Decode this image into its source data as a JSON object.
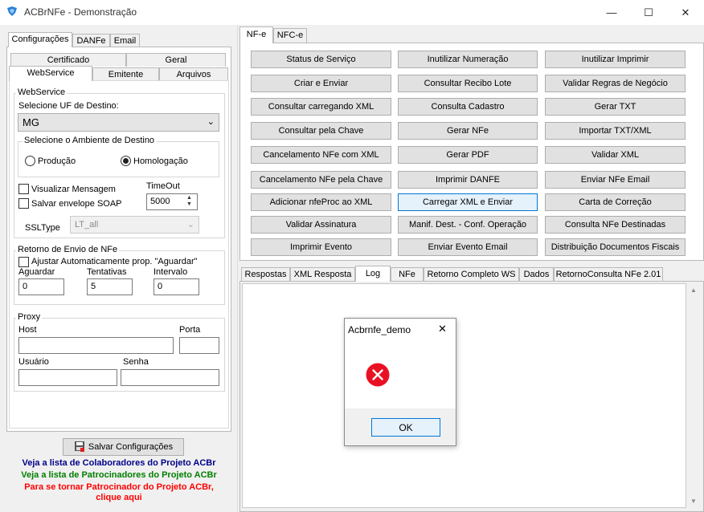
{
  "window": {
    "title": "ACBrNFe - Demonstração",
    "minimize": "—",
    "maximize": "☐",
    "close": "✕",
    "icon": "acbr-app-icon"
  },
  "left": {
    "tabs": [
      "Configurações",
      "DANFe",
      "Email"
    ],
    "subtabs_top": [
      "Certificado",
      "Geral"
    ],
    "subtabs_bottom": [
      "WebService",
      "Emitente",
      "Arquivos"
    ],
    "webservice": {
      "group_label": "WebService",
      "uf_label": "Selecione UF de Destino:",
      "uf_value": "MG",
      "ambiente_label": "Selecione o Ambiente de Destino",
      "producao": "Produção",
      "homologacao": "Homologação",
      "visualizar": "Visualizar Mensagem",
      "salvar_envelope": "Salvar envelope SOAP",
      "timeout_label": "TimeOut",
      "timeout_value": "5000",
      "ssltype_label": "SSLType",
      "ssltype_value": "LT_all"
    },
    "retorno": {
      "group_label": "Retorno de Envio de NFe",
      "ajustar": "Ajustar Automaticamente prop. \"Aguardar\"",
      "aguardar_label": "Aguardar",
      "aguardar_value": "0",
      "tentativas_label": "Tentativas",
      "tentativas_value": "5",
      "intervalo_label": "Intervalo",
      "intervalo_value": "0"
    },
    "proxy": {
      "group_label": "Proxy",
      "host_label": "Host",
      "porta_label": "Porta",
      "usuario_label": "Usuário",
      "senha_label": "Senha"
    },
    "save_button": "Salvar Configurações",
    "links": {
      "colaboradores": "Veja a lista de Colaboradores do Projeto ACBr",
      "patrocinadores": "Veja a lista de Patrocinadores do Projeto ACBr",
      "patrocinador_line1": "Para se tornar Patrocinador do Projeto ACBr,",
      "patrocinador_line2": "clique aqui"
    },
    "colors": {
      "blue": "#00008b",
      "green": "#008000",
      "red": "#ff0000"
    }
  },
  "right": {
    "tabs": [
      "NF-e",
      "NFC-e"
    ],
    "buttons": [
      [
        "Status de Serviço",
        "Inutilizar Numeração",
        "Inutilizar Imprimir"
      ],
      [
        "Criar e Enviar",
        "Consultar Recibo Lote",
        "Validar Regras de Negócio"
      ],
      [
        "Consultar carregando XML",
        "Consulta Cadastro",
        "Gerar TXT"
      ],
      [
        "Consultar pela Chave",
        "Gerar NFe",
        "Importar TXT/XML"
      ],
      [
        "Cancelamento NFe com XML",
        "Gerar PDF",
        "Validar XML"
      ],
      [
        "Cancelamento NFe pela Chave",
        "Imprimir DANFE",
        "Enviar NFe Email"
      ],
      [
        "Adicionar nfeProc ao XML",
        "Carregar XML e Enviar",
        "Carta de Correção"
      ],
      [
        "Validar Assinatura",
        "Manif. Dest. - Conf. Operação",
        "Consulta NFe Destinadas"
      ],
      [
        "Imprimir Evento",
        "Enviar Evento Email",
        "Distribuição Documentos Fiscais"
      ]
    ],
    "result_tabs": [
      "Respostas",
      "XML Resposta",
      "Log",
      "NFe",
      "Retorno Completo WS",
      "Dados",
      "RetornoConsulta NFe 2.01"
    ]
  },
  "dialog": {
    "title": "Acbrnfe_demo",
    "close": "✕",
    "icon": "error-icon",
    "ok": "OK",
    "error_color": "#e81123"
  }
}
